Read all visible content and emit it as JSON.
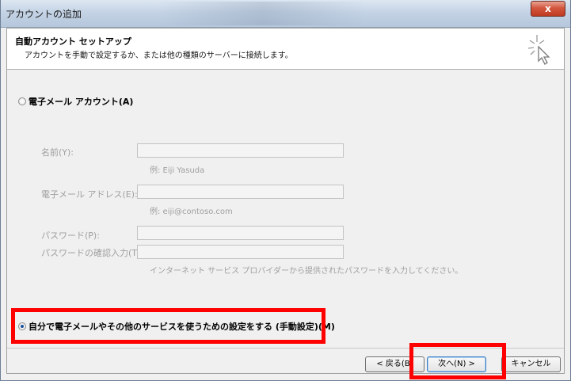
{
  "window": {
    "title": "アカウントの追加",
    "close_label": "x"
  },
  "header": {
    "title": "自動アカウント セットアップ",
    "description": "アカウントを手動で設定するか、または他の種類のサーバーに接続します。"
  },
  "email_account_option": {
    "label": "電子メール アカウント(A)",
    "selected": false
  },
  "fields": {
    "name_label": "名前(Y):",
    "name_value": "",
    "name_example": "例: Eiji Yasuda",
    "email_label": "電子メール アドレス(E):",
    "email_value": "",
    "email_example": "例: eiji@contoso.com",
    "password_label": "パスワード(P):",
    "password_value": "",
    "confirm_label": "パスワードの確認入力(T):",
    "confirm_value": "",
    "password_hint": "インターネット サービス プロバイダーから提供されたパスワードを入力してください。"
  },
  "manual_option": {
    "label": "自分で電子メールやその他のサービスを使うための設定をする (手動設定)(M)",
    "selected": true
  },
  "buttons": {
    "back": "< 戻る(B)",
    "next": "次へ(N) >",
    "cancel": "キャンセル"
  },
  "colors": {
    "highlight": "#ff0000",
    "dialog_bg": "#f0f0f0",
    "header_bg": "#ffffff",
    "disabled_text": "#a0a0a0"
  }
}
